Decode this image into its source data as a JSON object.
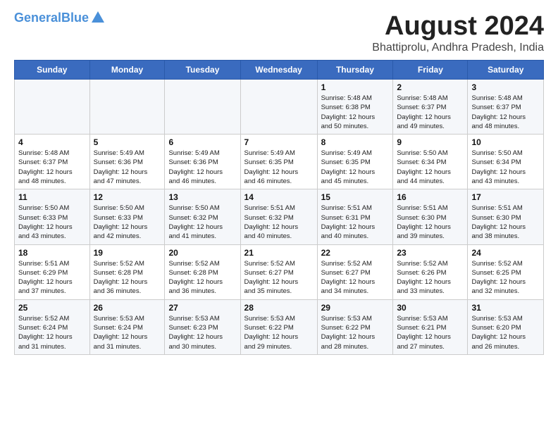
{
  "header": {
    "logo_line1": "General",
    "logo_line2": "Blue",
    "main_title": "August 2024",
    "subtitle": "Bhattiprolu, Andhra Pradesh, India"
  },
  "days_of_week": [
    "Sunday",
    "Monday",
    "Tuesday",
    "Wednesday",
    "Thursday",
    "Friday",
    "Saturday"
  ],
  "weeks": [
    [
      {
        "num": "",
        "info": ""
      },
      {
        "num": "",
        "info": ""
      },
      {
        "num": "",
        "info": ""
      },
      {
        "num": "",
        "info": ""
      },
      {
        "num": "1",
        "info": "Sunrise: 5:48 AM\nSunset: 6:38 PM\nDaylight: 12 hours\nand 50 minutes."
      },
      {
        "num": "2",
        "info": "Sunrise: 5:48 AM\nSunset: 6:37 PM\nDaylight: 12 hours\nand 49 minutes."
      },
      {
        "num": "3",
        "info": "Sunrise: 5:48 AM\nSunset: 6:37 PM\nDaylight: 12 hours\nand 48 minutes."
      }
    ],
    [
      {
        "num": "4",
        "info": "Sunrise: 5:48 AM\nSunset: 6:37 PM\nDaylight: 12 hours\nand 48 minutes."
      },
      {
        "num": "5",
        "info": "Sunrise: 5:49 AM\nSunset: 6:36 PM\nDaylight: 12 hours\nand 47 minutes."
      },
      {
        "num": "6",
        "info": "Sunrise: 5:49 AM\nSunset: 6:36 PM\nDaylight: 12 hours\nand 46 minutes."
      },
      {
        "num": "7",
        "info": "Sunrise: 5:49 AM\nSunset: 6:35 PM\nDaylight: 12 hours\nand 46 minutes."
      },
      {
        "num": "8",
        "info": "Sunrise: 5:49 AM\nSunset: 6:35 PM\nDaylight: 12 hours\nand 45 minutes."
      },
      {
        "num": "9",
        "info": "Sunrise: 5:50 AM\nSunset: 6:34 PM\nDaylight: 12 hours\nand 44 minutes."
      },
      {
        "num": "10",
        "info": "Sunrise: 5:50 AM\nSunset: 6:34 PM\nDaylight: 12 hours\nand 43 minutes."
      }
    ],
    [
      {
        "num": "11",
        "info": "Sunrise: 5:50 AM\nSunset: 6:33 PM\nDaylight: 12 hours\nand 43 minutes."
      },
      {
        "num": "12",
        "info": "Sunrise: 5:50 AM\nSunset: 6:33 PM\nDaylight: 12 hours\nand 42 minutes."
      },
      {
        "num": "13",
        "info": "Sunrise: 5:50 AM\nSunset: 6:32 PM\nDaylight: 12 hours\nand 41 minutes."
      },
      {
        "num": "14",
        "info": "Sunrise: 5:51 AM\nSunset: 6:32 PM\nDaylight: 12 hours\nand 40 minutes."
      },
      {
        "num": "15",
        "info": "Sunrise: 5:51 AM\nSunset: 6:31 PM\nDaylight: 12 hours\nand 40 minutes."
      },
      {
        "num": "16",
        "info": "Sunrise: 5:51 AM\nSunset: 6:30 PM\nDaylight: 12 hours\nand 39 minutes."
      },
      {
        "num": "17",
        "info": "Sunrise: 5:51 AM\nSunset: 6:30 PM\nDaylight: 12 hours\nand 38 minutes."
      }
    ],
    [
      {
        "num": "18",
        "info": "Sunrise: 5:51 AM\nSunset: 6:29 PM\nDaylight: 12 hours\nand 37 minutes."
      },
      {
        "num": "19",
        "info": "Sunrise: 5:52 AM\nSunset: 6:28 PM\nDaylight: 12 hours\nand 36 minutes."
      },
      {
        "num": "20",
        "info": "Sunrise: 5:52 AM\nSunset: 6:28 PM\nDaylight: 12 hours\nand 36 minutes."
      },
      {
        "num": "21",
        "info": "Sunrise: 5:52 AM\nSunset: 6:27 PM\nDaylight: 12 hours\nand 35 minutes."
      },
      {
        "num": "22",
        "info": "Sunrise: 5:52 AM\nSunset: 6:27 PM\nDaylight: 12 hours\nand 34 minutes."
      },
      {
        "num": "23",
        "info": "Sunrise: 5:52 AM\nSunset: 6:26 PM\nDaylight: 12 hours\nand 33 minutes."
      },
      {
        "num": "24",
        "info": "Sunrise: 5:52 AM\nSunset: 6:25 PM\nDaylight: 12 hours\nand 32 minutes."
      }
    ],
    [
      {
        "num": "25",
        "info": "Sunrise: 5:52 AM\nSunset: 6:24 PM\nDaylight: 12 hours\nand 31 minutes."
      },
      {
        "num": "26",
        "info": "Sunrise: 5:53 AM\nSunset: 6:24 PM\nDaylight: 12 hours\nand 31 minutes."
      },
      {
        "num": "27",
        "info": "Sunrise: 5:53 AM\nSunset: 6:23 PM\nDaylight: 12 hours\nand 30 minutes."
      },
      {
        "num": "28",
        "info": "Sunrise: 5:53 AM\nSunset: 6:22 PM\nDaylight: 12 hours\nand 29 minutes."
      },
      {
        "num": "29",
        "info": "Sunrise: 5:53 AM\nSunset: 6:22 PM\nDaylight: 12 hours\nand 28 minutes."
      },
      {
        "num": "30",
        "info": "Sunrise: 5:53 AM\nSunset: 6:21 PM\nDaylight: 12 hours\nand 27 minutes."
      },
      {
        "num": "31",
        "info": "Sunrise: 5:53 AM\nSunset: 6:20 PM\nDaylight: 12 hours\nand 26 minutes."
      }
    ]
  ]
}
